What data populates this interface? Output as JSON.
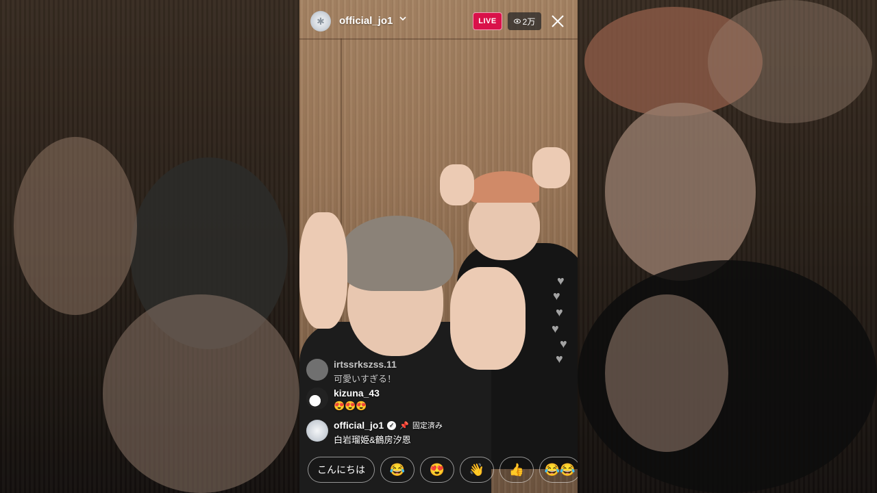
{
  "header": {
    "username": "official_jo1",
    "live_label": "LIVE",
    "viewer_count": "2万"
  },
  "comments": [
    {
      "username": "irtssrkszss.11",
      "text": "可愛いすぎる！"
    },
    {
      "username": "kizuna_43",
      "text": "😍😍😍"
    },
    {
      "username": "official_jo1",
      "text": "白岩瑠姫&鶴房汐恩",
      "pinned_label": "固定済み"
    }
  ],
  "quick_reactions": {
    "greeting": "こんにちは",
    "emojis": [
      "😂",
      "😍",
      "👋",
      "👍",
      "😂😂"
    ]
  },
  "colors": {
    "live_badge": "#d9124a",
    "viewer_badge_bg": "#282828"
  }
}
